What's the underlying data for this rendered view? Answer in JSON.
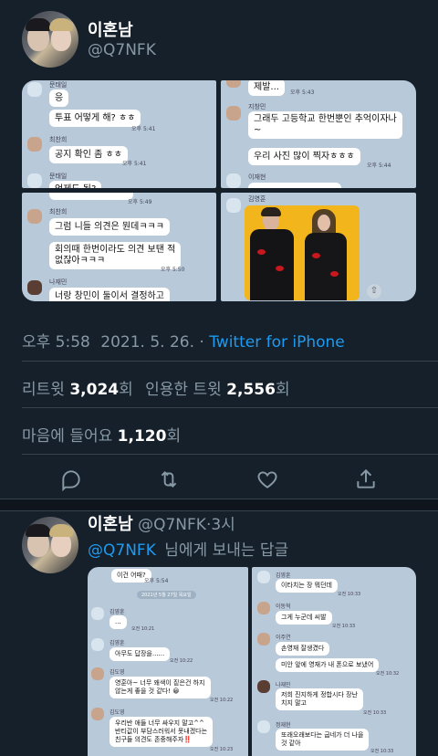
{
  "tweet": {
    "display_name": "이혼남",
    "handle": "@Q7NFK",
    "timestamp_time": "오후 5:58",
    "timestamp_date": "2021. 5. 26.",
    "dot": "·",
    "source": "Twitter for iPhone",
    "retweets_label": "리트윗",
    "retweets_count": "3,024",
    "count_suffix": "회",
    "quotes_label": "인용한 트윗",
    "quotes_count": "2,556",
    "likes_label": "마음에 들어요",
    "likes_count": "1,120",
    "images": {
      "img1": {
        "top_name": "문태일",
        "b1": "응",
        "b2": "투표 어떻게 해? ㅎㅎ",
        "t2": "오후 5:41",
        "name2": "최찬희",
        "b3": "공지 확인 좀 ㅎㅎ",
        "t3": "오후 5:41",
        "name3": "문태일",
        "b4": "언제도 됨?"
      },
      "img2": {
        "b1": "제발...",
        "t1": "오후 5:43",
        "name1": "지창민",
        "b2a": "그래두 고등학교 한번뿐인 추억이자나",
        "b2b": "~",
        "b3": "우리 사진 많이 찍자ㅎㅎㅎ",
        "t3": "오후 5:44",
        "name2": "이재현"
      },
      "img3": {
        "t0": "오후 5:49",
        "name1": "최찬희",
        "b1": "그럼 니들 의견은 뭔데ㅋㅋㅋ",
        "b2a": "회의때 한번이라도 의견 보탠 적",
        "b2b": "없잖아ㅋㅋㅋ",
        "t2": "오후 5:50",
        "name2": "나재민",
        "b3": "너랑 창민이 둘이서 결정하고"
      },
      "img4": {
        "name1": "김영훈"
      }
    }
  },
  "reply": {
    "display_name": "이혼남",
    "handle": "@Q7NFK",
    "dot": "·",
    "time": "3시",
    "mention": "@Q7NFK",
    "replying_text": "님에게 보내는 답글",
    "images": {
      "left": {
        "b0": "이건 어때?",
        "t0": "오후 5:54",
        "date_chip": "2021년 5월 27일 목요일",
        "n1": "김영훈",
        "b1": "...",
        "t1": "오전 10:21",
        "n2": "김영훈",
        "b2": "아무도 답장을......",
        "t2": "오전 10:22",
        "n3": "김도영",
        "b3a": "영훈아~ 너무 왜색이 짙은건 하지",
        "b3b": "않는게 좋을 것 같다! 😀",
        "t3": "오전 10:22",
        "n4": "김도영",
        "b4a": "우리반 애들 너무 싸우지 말고^^",
        "b4b": "반티값이 부담스러워서 못내겠다는",
        "b4c": "친구들 의견도 존중해주자‼️",
        "t4": "오전 10:23"
      },
      "right": {
        "n1": "김영훈",
        "b1": "이타치는 장 뭐던데",
        "t1": "오전 10:33",
        "n2": "이동혁",
        "b2": "그게 누군데 씨발",
        "t2": "오전 10:33",
        "n3": "이주연",
        "b3": "손영재 잘생겼다",
        "b4": "미안 앞에 영재가 내 폰으로 보냈어",
        "t4": "오전 10:32",
        "n5": "나재민",
        "b5a": "저희 진지하게 정합시다 장난",
        "b5b": "치지 말고",
        "t5": "오전 10:33",
        "n6": "정재현",
        "b6a": "또래오래보다는 굽네가 더 나을",
        "b6b": "것 같아",
        "t6": "오전 10:33"
      }
    }
  }
}
